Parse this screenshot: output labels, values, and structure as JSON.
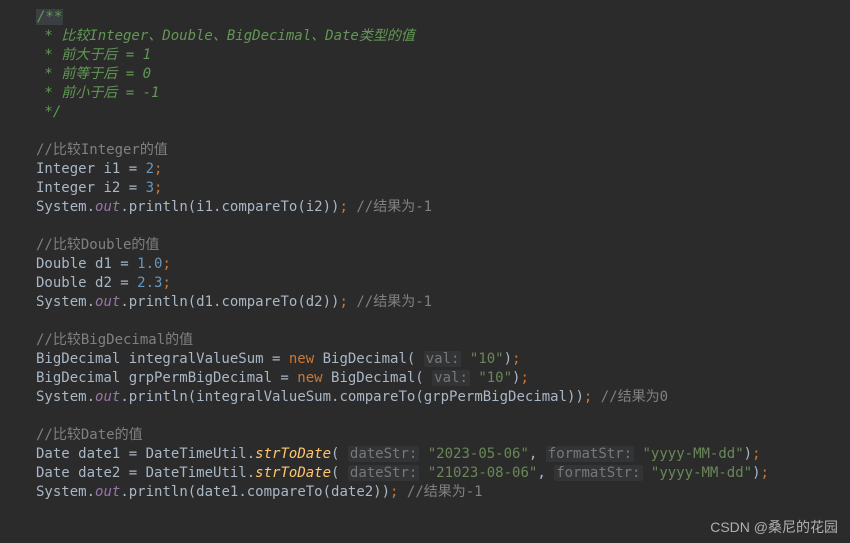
{
  "doc": {
    "open": "/**",
    "l1": " * 比较Integer、Double、BigDecimal、Date类型的值",
    "l2": " * 前大于后 = 1",
    "l3": " * 前等于后 = 0",
    "l4": " * 前小于后 = -1",
    "close": " */"
  },
  "section_int": {
    "comment": "//比较Integer的值",
    "line1_type": "Integer ",
    "line1_var": "i1 = ",
    "line1_val": "2",
    "line2_type": "Integer ",
    "line2_var": "i2 = ",
    "line2_val": "3",
    "print_cls": "System.",
    "print_out": "out",
    "print_dot": ".println(i1.compareTo(i2))",
    "print_comment": " //结果为-1"
  },
  "section_double": {
    "comment": "//比较Double的值",
    "line1_type": "Double ",
    "line1_var": "d1 = ",
    "line1_val": "1.0",
    "line2_type": "Double ",
    "line2_var": "d2 = ",
    "line2_val": "2.3",
    "print_cls": "System.",
    "print_out": "out",
    "print_dot": ".println(d1.compareTo(d2))",
    "print_comment": " //结果为-1"
  },
  "section_bigdecimal": {
    "comment": "//比较BigDecimal的值",
    "line1_type": "BigDecimal ",
    "line1_var": "integralValueSum = ",
    "line1_new": "new ",
    "line1_ctor": "BigDecimal( ",
    "line1_hint": "val:",
    "line1_val": " \"10\"",
    "line1_close": ")",
    "line2_type": "BigDecimal ",
    "line2_var": "grpPermBigDecimal = ",
    "line2_new": "new ",
    "line2_ctor": "BigDecimal( ",
    "line2_hint": "val:",
    "line2_val": " \"10\"",
    "line2_close": ")",
    "print_cls": "System.",
    "print_out": "out",
    "print_dot": ".println(integralValueSum.compareTo(grpPermBigDecimal))",
    "print_comment": " //结果为0"
  },
  "section_date": {
    "comment": "//比较Date的值",
    "line1_type": "Date ",
    "line1_var": "date1 = DateTimeUtil.",
    "line1_method": "strToDate",
    "line1_open": "( ",
    "line1_hint1": "dateStr:",
    "line1_val1": " \"2023-05-06\"",
    "line1_comma": ", ",
    "line1_hint2": "formatStr:",
    "line1_val2": " \"yyyy-MM-dd\"",
    "line1_close": ")",
    "line2_type": "Date ",
    "line2_var": "date2 = DateTimeUtil.",
    "line2_method": "strToDate",
    "line2_open": "( ",
    "line2_hint1": "dateStr:",
    "line2_val1": " \"21023-08-06\"",
    "line2_comma": ", ",
    "line2_hint2": "formatStr:",
    "line2_val2": " \"yyyy-MM-dd\"",
    "line2_close": ")",
    "print_cls": "System.",
    "print_out": "out",
    "print_dot": ".println(date1.compareTo(date2))",
    "print_comment": " //结果为-1"
  },
  "semi": ";",
  "watermark": "CSDN @桑尼的花园"
}
